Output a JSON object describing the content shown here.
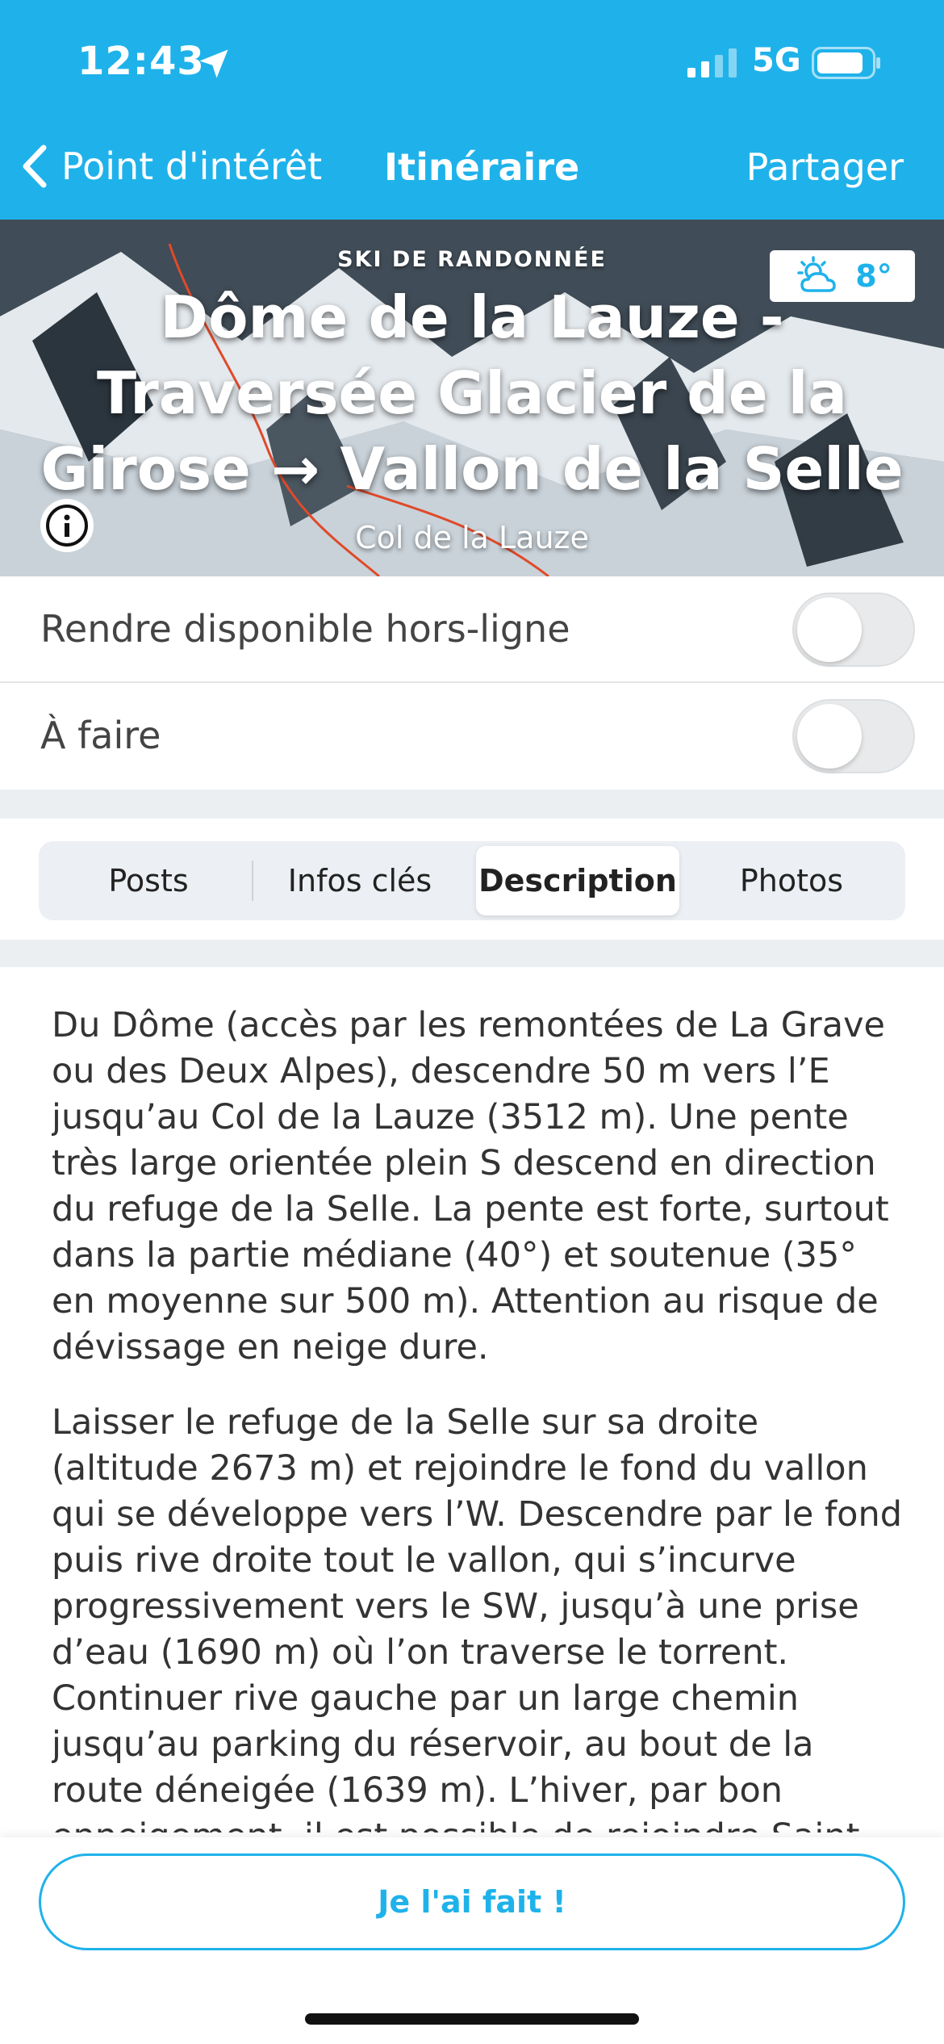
{
  "status_bar": {
    "time": "12:43",
    "network": "5G",
    "location_icon": "location-arrow-icon",
    "signal_icon": "signal-bars-icon",
    "battery_icon": "battery-icon"
  },
  "nav": {
    "back_label": "Point d'intérêt",
    "title": "Itinéraire",
    "share_label": "Partager"
  },
  "hero": {
    "activity": "SKI DE RANDONNÉE",
    "title": "Dôme de la Lauze - Traversée Glacier de la Girose → Vallon de la Selle",
    "subtitle": "Col de la Lauze",
    "weather_temp": "8°",
    "weather_icon": "partly-sunny-icon"
  },
  "toggles": {
    "offline_label": "Rendre disponible hors-ligne",
    "offline_on": false,
    "todo_label": "À faire",
    "todo_on": false
  },
  "tabs": [
    "Posts",
    "Infos clés",
    "Description",
    "Photos"
  ],
  "active_tab": "Description",
  "description": {
    "paragraph1": "Du Dôme (accès par les remontées de La Grave ou des Deux Alpes), descendre 50 m vers l’E jusqu’au Col de la Lauze (3512 m). Une pente très large orientée plein S descend en direction du refuge de la Selle. La pente est forte, surtout dans la partie médiane (40°) et soutenue (35° en moyenne sur 500 m). Attention au risque de dévissage en neige dure.",
    "paragraph2": "Laisser le refuge de la Selle sur sa droite (altitude 2673 m) et rejoindre le fond du vallon qui se développe vers l’W. Descendre par le fond puis rive droite tout le vallon, qui s’incurve progressivement vers le SW, jusqu’à une prise d’eau (1690 m) où l’on traverse le torrent. Continuer rive gauche par un large chemin jusqu’au parking du réservoir, au bout de la route déneigée (1639 m). L’hiver, par bon enneigement, il est possible de rejoindre Saint"
  },
  "bottom": {
    "done_label": "Je l'ai fait !"
  },
  "colors": {
    "accent": "#1fb2ea",
    "text": "#333333",
    "band": "#eceff2"
  }
}
